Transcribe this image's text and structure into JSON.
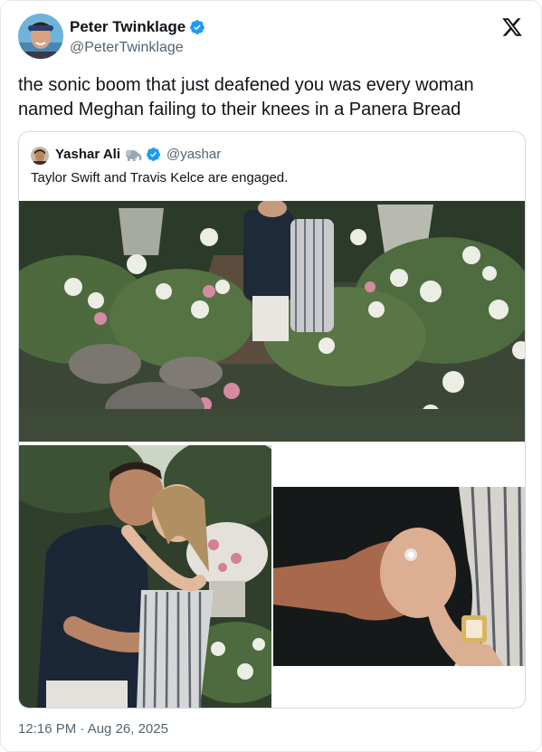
{
  "tweet": {
    "author_name": "Peter Twinklage",
    "author_handle": "@PeterTwinklage",
    "text": "the sonic boom that just deafened you was every woman named Meghan failing to their knees in a Panera Bread",
    "timestamp": "12:16 PM · Aug 26, 2025"
  },
  "quote": {
    "author_name": "Yashar Ali",
    "author_handle": "@yashar",
    "text": "Taylor Swift and Travis Kelce are engaged."
  },
  "icons": {
    "verified": "verified-badge-icon",
    "x_logo": "x-logo-icon",
    "elephant": "elephant-emoji-icon"
  },
  "colors": {
    "verified_blue": "#1d9bf0",
    "text_primary": "#0f1419",
    "text_secondary": "#536471",
    "border": "#cfd9de"
  }
}
